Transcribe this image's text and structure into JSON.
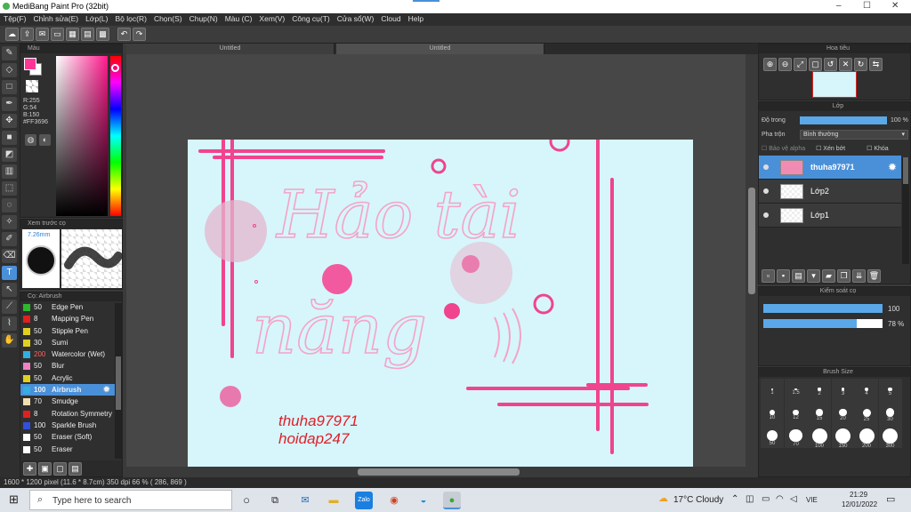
{
  "window": {
    "title": "MediBang Paint Pro (32bit)",
    "controls": [
      "–",
      "☐",
      "✕"
    ]
  },
  "menu": [
    "Tệp(F)",
    "Chỉnh sửa(E)",
    "Lớp(L)",
    "Bộ lọc(R)",
    "Chọn(S)",
    "Chụp(N)",
    "Màu (C)",
    "Xem(V)",
    "Công cụ(T)",
    "Cửa sổ(W)",
    "Cloud",
    "Help"
  ],
  "tabs": [
    "Untitled",
    "Untitled"
  ],
  "color_panel": {
    "title": "Màu",
    "r": "R:255",
    "g": "G:54",
    "b": "B:150",
    "hex": "#FF3696",
    "primary": "#FF3696"
  },
  "brush_preview": {
    "title": "Xem trước cọ",
    "size": "7.26mm"
  },
  "brush_panel": {
    "title": "Cọ: Airbrush",
    "items": [
      {
        "size": "50",
        "name": "Edge Pen",
        "color": "#2db82d"
      },
      {
        "size": "8",
        "name": "Mapping Pen",
        "color": "#e02020"
      },
      {
        "size": "50",
        "name": "Stipple Pen",
        "color": "#e0d020"
      },
      {
        "size": "30",
        "name": "Sumi",
        "color": "#e0d020"
      },
      {
        "size": "200",
        "name": "Watercolor (Wet)",
        "color": "#30b0e0"
      },
      {
        "size": "50",
        "name": "Blur",
        "color": "#f080c0"
      },
      {
        "size": "50",
        "name": "Acrylic",
        "color": "#e0d020"
      },
      {
        "size": "100",
        "name": "Airbrush",
        "color": "#30b0e0"
      },
      {
        "size": "70",
        "name": "Smudge",
        "color": "#f0e0b0"
      },
      {
        "size": "8",
        "name": "Rotation Symmetry",
        "color": "#e02020"
      },
      {
        "size": "100",
        "name": "Sparkle Brush",
        "color": "#3050e0"
      },
      {
        "size": "50",
        "name": "Eraser (Soft)",
        "color": "#ffffff"
      },
      {
        "size": "50",
        "name": "Eraser",
        "color": "#ffffff"
      }
    ]
  },
  "navigator": {
    "title": "Hoa tiêu"
  },
  "layer_panel": {
    "title": "Lớp",
    "opacity_label": "Độ trong",
    "opacity_value": "100 %",
    "opacity": 1.0,
    "blend_label": "Pha trộn",
    "blend_value": "Bình thường",
    "protect_alpha": "Bảo vệ alpha",
    "clip": "Xén bớt",
    "lock": "Khóa",
    "layers": [
      {
        "name": "thuha97971"
      },
      {
        "name": "Lớp2"
      },
      {
        "name": "Lớp1"
      }
    ]
  },
  "brush_control": {
    "title": "Kiểm soát cọ",
    "size_value": "100",
    "size_fraction": 1.0,
    "opacity_value": "78 %",
    "opacity_fraction": 0.78
  },
  "brush_size_panel": {
    "title": "Brush Size",
    "sizes": [
      "1",
      "1.5",
      "2",
      "3",
      "4",
      "5",
      "10",
      "12",
      "15",
      "20",
      "25",
      "30",
      "50",
      "70",
      "100",
      "150",
      "200",
      "300"
    ]
  },
  "canvas": {
    "handwriting_line1": "Hảo tài",
    "handwriting_line2": "năng",
    "signature_line1": "thuha97971",
    "signature_line2": "hoidap247",
    "bg": "#d6f6fb",
    "accent": "#f0448e"
  },
  "status": "1600 * 1200 pixel   (11.6 * 8.7cm)   350 dpi   66 %   ( 286, 869 )",
  "taskbar": {
    "search_placeholder": "Type here to search",
    "weather": "17°C  Cloudy",
    "lang": "VIE",
    "time": "21:29",
    "date": "12/01/2022"
  }
}
